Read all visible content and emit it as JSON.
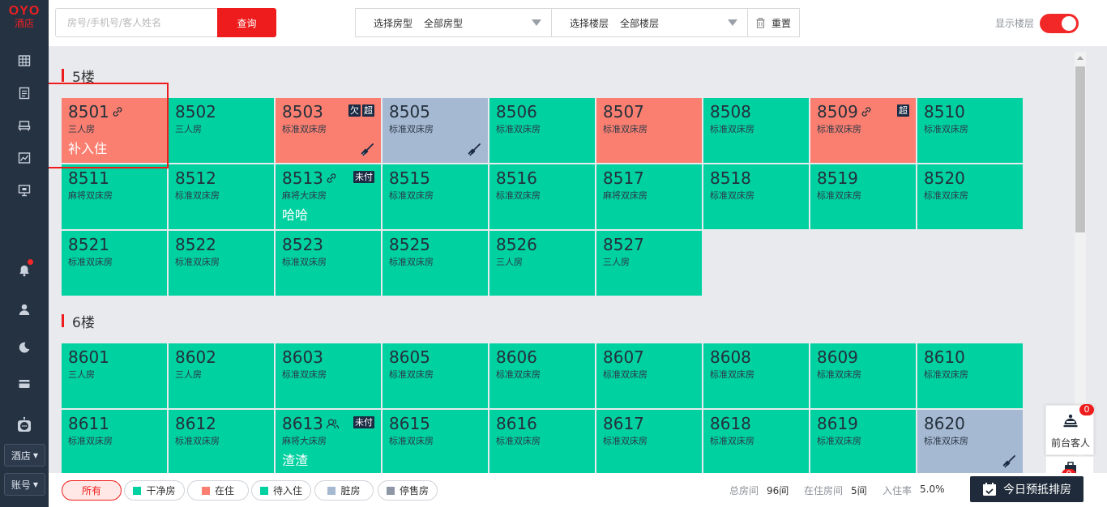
{
  "sidebar": {
    "logo_top": "OYO",
    "logo_bottom": "酒店",
    "hotel_select": "酒店",
    "account_select": "账号"
  },
  "topbar": {
    "search_placeholder": "房号/手机号/客人姓名",
    "query_label": "查询",
    "room_type_label": "选择房型",
    "room_type_value": "全部房型",
    "floor_label": "选择楼层",
    "floor_value": "全部楼层",
    "reset_label": "重置",
    "show_floor_label": "显示楼层",
    "show_floor_on": true
  },
  "floors": [
    {
      "title": "5楼",
      "rows": [
        [
          {
            "num": "8501",
            "type": "三人房",
            "status": "occupied",
            "link": true,
            "guest": "补入住"
          },
          {
            "num": "8502",
            "type": "三人房",
            "status": "clean"
          },
          {
            "num": "8503",
            "type": "标准双床房",
            "status": "occupied",
            "tags": [
              "欠",
              "超"
            ],
            "dirty_icon": true
          },
          {
            "num": "8505",
            "type": "标准双床房",
            "status": "dirty",
            "dirty_icon": true
          },
          {
            "num": "8506",
            "type": "标准双床房",
            "status": "clean"
          },
          {
            "num": "8507",
            "type": "标准双床房",
            "status": "occupied"
          },
          {
            "num": "8508",
            "type": "标准双床房",
            "status": "clean"
          },
          {
            "num": "8509",
            "type": "标准双床房",
            "status": "occupied",
            "link": true,
            "tags": [
              "超"
            ]
          },
          {
            "num": "8510",
            "type": "标准双床房",
            "status": "clean"
          }
        ],
        [
          {
            "num": "8511",
            "type": "麻将双床房",
            "status": "clean"
          },
          {
            "num": "8512",
            "type": "标准双床房",
            "status": "clean"
          },
          {
            "num": "8513",
            "type": "麻将大床房",
            "status": "clean",
            "link": true,
            "tags": [
              "未付"
            ],
            "guest": "哈哈"
          },
          {
            "num": "8515",
            "type": "标准双床房",
            "status": "clean"
          },
          {
            "num": "8516",
            "type": "标准双床房",
            "status": "clean"
          },
          {
            "num": "8517",
            "type": "麻将双床房",
            "status": "clean"
          },
          {
            "num": "8518",
            "type": "标准双床房",
            "status": "clean"
          },
          {
            "num": "8519",
            "type": "标准双床房",
            "status": "clean"
          },
          {
            "num": "8520",
            "type": "标准双床房",
            "status": "clean"
          }
        ],
        [
          {
            "num": "8521",
            "type": "标准双床房",
            "status": "clean"
          },
          {
            "num": "8522",
            "type": "标准双床房",
            "status": "clean"
          },
          {
            "num": "8523",
            "type": "标准双床房",
            "status": "clean"
          },
          {
            "num": "8525",
            "type": "标准双床房",
            "status": "clean"
          },
          {
            "num": "8526",
            "type": "三人房",
            "status": "clean"
          },
          {
            "num": "8527",
            "type": "三人房",
            "status": "clean"
          }
        ]
      ]
    },
    {
      "title": "6楼",
      "rows": [
        [
          {
            "num": "8601",
            "type": "三人房",
            "status": "clean"
          },
          {
            "num": "8602",
            "type": "三人房",
            "status": "clean"
          },
          {
            "num": "8603",
            "type": "标准双床房",
            "status": "clean"
          },
          {
            "num": "8605",
            "type": "标准双床房",
            "status": "clean"
          },
          {
            "num": "8606",
            "type": "标准双床房",
            "status": "clean"
          },
          {
            "num": "8607",
            "type": "标准双床房",
            "status": "clean"
          },
          {
            "num": "8608",
            "type": "标准双床房",
            "status": "clean"
          },
          {
            "num": "8609",
            "type": "标准双床房",
            "status": "clean"
          },
          {
            "num": "8610",
            "type": "标准双床房",
            "status": "clean"
          }
        ],
        [
          {
            "num": "8611",
            "type": "标准双床房",
            "status": "clean"
          },
          {
            "num": "8612",
            "type": "标准双床房",
            "status": "clean"
          },
          {
            "num": "8613",
            "type": "麻将大床房",
            "status": "clean",
            "group": true,
            "tags": [
              "未付"
            ],
            "guest": "渣渣"
          },
          {
            "num": "8615",
            "type": "标准双床房",
            "status": "clean"
          },
          {
            "num": "8616",
            "type": "标准双床房",
            "status": "clean"
          },
          {
            "num": "8617",
            "type": "标准双床房",
            "status": "clean"
          },
          {
            "num": "8618",
            "type": "标准双床房",
            "status": "clean"
          },
          {
            "num": "8619",
            "type": "标准双床房",
            "status": "clean"
          },
          {
            "num": "8620",
            "type": "标准双床房",
            "status": "dirty",
            "dirty_icon": true
          }
        ]
      ]
    }
  ],
  "colors": {
    "clean": "#00d1a0",
    "occupied": "#fb7f70",
    "dirty": "#a6b9d2",
    "stop_sale": "#8e97a6",
    "accent": "#ee1c1c"
  },
  "legend": [
    {
      "label": "所有",
      "color": null,
      "active": true
    },
    {
      "label": "干净房",
      "color": "#00d1a0"
    },
    {
      "label": "在住",
      "color": "#fb7f70"
    },
    {
      "label": "待入住",
      "color": "#00d1a0"
    },
    {
      "label": "脏房",
      "color": "#a6b9d2"
    },
    {
      "label": "停售房",
      "color": "#8e97a6"
    }
  ],
  "stats": {
    "total_label": "总房间",
    "total_value": "96间",
    "occupied_label": "在住房间",
    "occupied_value": "5间",
    "rate_label": "入住率",
    "rate_value": "5.0%"
  },
  "widgets": {
    "front_desk_label": "前台客人",
    "front_desk_count": "0",
    "second_count": "0",
    "today_button": "今日预抵排房"
  }
}
